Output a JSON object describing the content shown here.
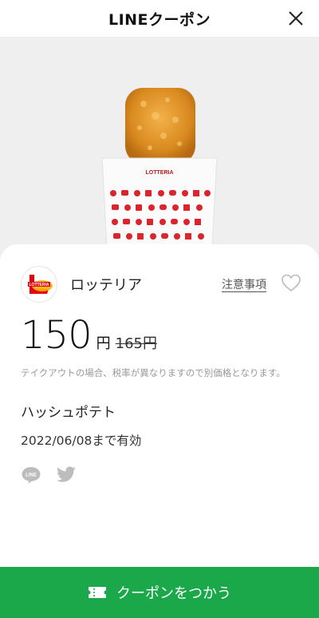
{
  "header": {
    "title": "LINEクーポン"
  },
  "store": {
    "name": "ロッテリア",
    "notes_label": "注意事項"
  },
  "coupon": {
    "price": "150",
    "price_unit": "円",
    "original_price": "165円",
    "note": "テイクアウトの場合、税率が異なりますので別価格となります。",
    "item_name": "ハッシュポテト",
    "validity": "2022/06/08まで有効"
  },
  "cta": {
    "label": "クーポンをつかう"
  },
  "icons": {
    "close": "close-icon",
    "heart": "heart-icon",
    "line_share": "line-icon",
    "twitter_share": "twitter-icon",
    "ticket": "ticket-icon"
  },
  "colors": {
    "accent": "#1aa84a",
    "brand_red": "#e60012"
  }
}
